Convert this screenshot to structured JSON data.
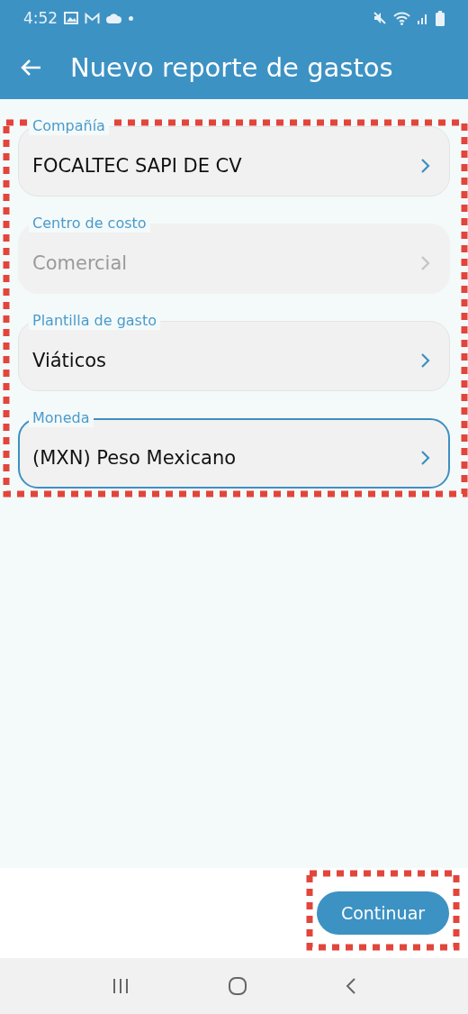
{
  "status_bar": {
    "time": "4:52"
  },
  "app_bar": {
    "title": "Nuevo reporte de gastos"
  },
  "fields": [
    {
      "label": "Compañía",
      "value": "FOCALTEC SAPI DE CV",
      "disabled": false,
      "focused": false
    },
    {
      "label": "Centro de costo",
      "value": "Comercial",
      "disabled": true,
      "focused": false
    },
    {
      "label": "Plantilla de gasto",
      "value": "Viáticos",
      "disabled": false,
      "focused": false
    },
    {
      "label": "Moneda",
      "value": "(MXN) Peso Mexicano",
      "disabled": false,
      "focused": true
    }
  ],
  "continue_button": {
    "label": "Continuar"
  }
}
